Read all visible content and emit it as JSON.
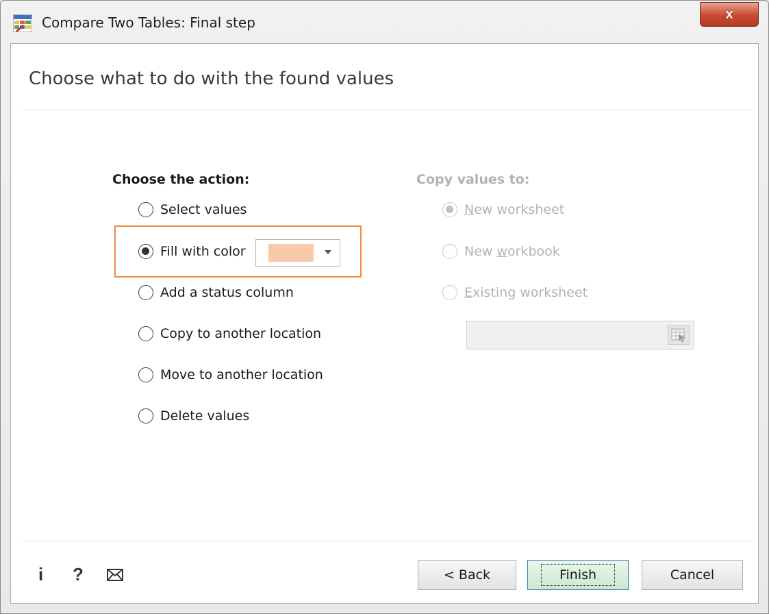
{
  "window": {
    "title": "Compare Two Tables: Final step",
    "close_label": "x"
  },
  "heading": "Choose what to do with the found values",
  "actions": {
    "label": "Choose the action:",
    "options": [
      {
        "label": "Select values",
        "checked": false
      },
      {
        "label": "Fill with color",
        "checked": true
      },
      {
        "label": "Add a status column",
        "checked": false
      },
      {
        "label": "Copy to another location",
        "checked": false
      },
      {
        "label": "Move to another location",
        "checked": false
      },
      {
        "label": "Delete values",
        "checked": false
      }
    ],
    "fill_color": "#f8c9ab",
    "highlight_color": "#ef8a3e"
  },
  "copy_to": {
    "label": "Copy values to:",
    "enabled": false,
    "options": [
      {
        "label": "New worksheet",
        "checked": true,
        "mnemonic": "N"
      },
      {
        "label": "New workbook",
        "checked": false,
        "mnemonic": "w"
      },
      {
        "label": "Existing worksheet",
        "checked": false,
        "mnemonic": "E"
      }
    ],
    "location_value": ""
  },
  "footer": {
    "info_icon": "i",
    "help_icon": "?",
    "mail_icon": "envelope",
    "back_label": "< Back",
    "finish_label": "Finish",
    "cancel_label": "Cancel"
  }
}
